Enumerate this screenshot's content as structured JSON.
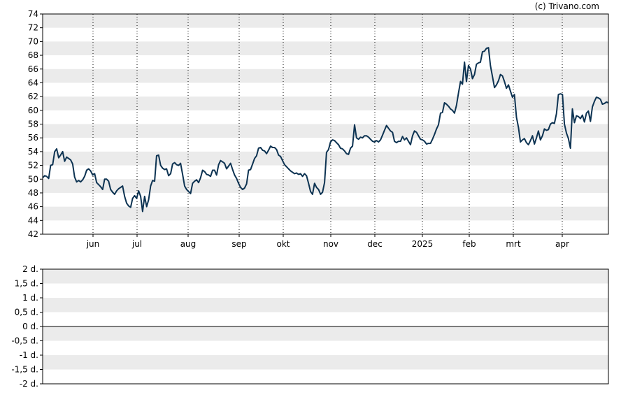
{
  "credit": "(c) Trivano.com",
  "colors": {
    "line": "#0d3352",
    "band": "#ebebeb",
    "frame": "#000000",
    "grid_vertical": "#000000"
  },
  "chart_data": [
    {
      "type": "line",
      "title": "",
      "xlabel": "",
      "ylabel": "",
      "ylim": [
        42,
        74
      ],
      "y_ticks": [
        42,
        44,
        46,
        48,
        50,
        52,
        54,
        56,
        58,
        60,
        62,
        64,
        66,
        68,
        70,
        72,
        74
      ],
      "x_ticks": [
        "jun",
        "jul",
        "aug",
        "sep",
        "okt",
        "nov",
        "dec",
        "2025",
        "feb",
        "mrt",
        "apr"
      ],
      "grid": "alternating horizontal bands, dotted vertical lines at month ticks",
      "series": [
        {
          "values": [
            50.2,
            50.5,
            50.4,
            50.1,
            52.0,
            52.1,
            54.0,
            54.4,
            53.1,
            53.5,
            54.0,
            52.6,
            53.2,
            53.0,
            52.8,
            52.2,
            50.3,
            49.6,
            49.8,
            49.6,
            49.9,
            50.4,
            51.3,
            51.5,
            51.2,
            50.6,
            50.8,
            49.5,
            49.2,
            48.9,
            48.5,
            50.0,
            50.0,
            49.7,
            48.5,
            48.1,
            47.8,
            48.3,
            48.6,
            48.8,
            49.0,
            47.5,
            46.5,
            46.1,
            45.9,
            47.2,
            47.6,
            47.2,
            48.3,
            47.5,
            45.3,
            47.5,
            46.0,
            47.0,
            49.0,
            49.8,
            49.7,
            53.4,
            53.5,
            52.0,
            51.6,
            51.4,
            51.5,
            50.5,
            50.8,
            52.2,
            52.4,
            52.1,
            52.0,
            52.3,
            50.7,
            49.0,
            48.5,
            48.2,
            47.9,
            49.4,
            49.7,
            49.9,
            49.5,
            50.2,
            51.3,
            51.1,
            50.7,
            50.6,
            50.4,
            51.3,
            51.3,
            50.6,
            52.1,
            52.7,
            52.5,
            52.3,
            51.5,
            51.9,
            52.3,
            51.4,
            50.6,
            50.1,
            49.4,
            48.8,
            48.5,
            48.7,
            49.3,
            51.3,
            51.4,
            52.2,
            53.0,
            53.4,
            54.5,
            54.6,
            54.2,
            54.1,
            53.7,
            54.2,
            54.8,
            54.6,
            54.6,
            54.3,
            53.5,
            53.3,
            52.7,
            52.1,
            51.8,
            51.5,
            51.2,
            51.0,
            50.8,
            50.9,
            50.7,
            50.8,
            50.4,
            50.8,
            50.5,
            49.4,
            48.2,
            47.8,
            49.4,
            48.8,
            48.5,
            47.8,
            48.1,
            49.5,
            53.9,
            54.3,
            55.4,
            55.7,
            55.6,
            55.3,
            55.0,
            54.5,
            54.4,
            54.1,
            53.7,
            53.6,
            54.5,
            54.8,
            57.9,
            56.0,
            55.8,
            56.1,
            56.0,
            56.3,
            56.3,
            56.1,
            55.8,
            55.5,
            55.4,
            55.6,
            55.4,
            55.7,
            56.4,
            57.1,
            57.8,
            57.4,
            57.0,
            56.8,
            55.5,
            55.3,
            55.5,
            55.5,
            56.2,
            55.7,
            56.0,
            55.5,
            55.0,
            56.3,
            57.0,
            56.8,
            56.3,
            55.8,
            55.7,
            55.5,
            55.1,
            55.2,
            55.2,
            55.8,
            56.5,
            57.3,
            57.9,
            59.6,
            59.7,
            61.1,
            60.9,
            60.6,
            60.2,
            60.0,
            59.6,
            60.7,
            62.5,
            64.2,
            63.8,
            67.0,
            64.2,
            66.5,
            66.0,
            64.6,
            65.2,
            66.7,
            66.9,
            67.0,
            68.5,
            68.6,
            69.0,
            69.1,
            66.5,
            64.9,
            63.3,
            63.7,
            64.3,
            65.2,
            65.0,
            64.2,
            63.2,
            63.7,
            62.8,
            61.9,
            62.3,
            59.0,
            57.5,
            55.4,
            55.7,
            55.9,
            55.3,
            55.0,
            55.6,
            56.3,
            55.1,
            56.0,
            57.0,
            55.7,
            56.3,
            57.3,
            57.1,
            57.2,
            58.0,
            58.2,
            58.1,
            59.5,
            62.3,
            62.4,
            62.3,
            58.0,
            56.7,
            55.9,
            54.5,
            60.2,
            58.2,
            59.2,
            59.1,
            58.8,
            59.3,
            58.3,
            59.6,
            59.9,
            58.4,
            60.5,
            61.3,
            61.9,
            61.8,
            61.6,
            60.9,
            61.0,
            61.2,
            61.1
          ]
        }
      ]
    },
    {
      "type": "line",
      "title": "",
      "xlabel": "",
      "ylabel": "",
      "ylim": [
        -2,
        2
      ],
      "y_ticks": [
        "2 d.",
        "1,5 d.",
        "1 d.",
        "0,5 d.",
        "0 d.",
        "-0,5 d.",
        "-1 d.",
        "-1,5 d.",
        "-2 d."
      ],
      "baseline": 0,
      "grid": "alternating horizontal bands",
      "series": []
    }
  ]
}
